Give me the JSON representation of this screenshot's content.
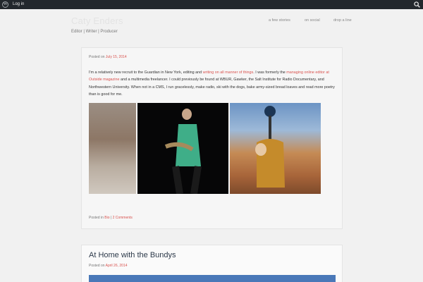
{
  "admin_bar": {
    "login_label": "Log in"
  },
  "site": {
    "title": "Caty Enders",
    "tagline": "Editor | Writer | Producer"
  },
  "nav": {
    "items": [
      {
        "label": "a few stories"
      },
      {
        "label": "on social"
      },
      {
        "label": "drop a line"
      }
    ]
  },
  "post1": {
    "posted_on_label": "Posted on",
    "date": "July 15, 2014",
    "body": [
      {
        "text": "I'm a relatively new recruit to the Guardian in New York, editing and "
      },
      {
        "text": "writing on all manner of things",
        "link": true
      },
      {
        "text": ". I was formerly the "
      },
      {
        "text": "managing online editor at Outside magazine",
        "link": true
      },
      {
        "text": " and a multimedia freelancer. I could previously be found at WBUR, Gawker, the Salt Institute for Radio Documentary,  and Northwestern University. When not in a CMS, I run gracelessly, make radio, ski with the dogs, bake army-sized bread loaves and read more poetry than is good for me."
      }
    ],
    "posted_in_label": "Posted in",
    "category": "Bio",
    "separator": "|",
    "comments": "2 Comments"
  },
  "post2": {
    "title": "At Home with the Bundys",
    "posted_on_label": "Posted on",
    "date": "April 26, 2014"
  },
  "colors": {
    "link": "#d9534f",
    "admin_bar": "#23282d",
    "background": "#f1f1f1"
  }
}
